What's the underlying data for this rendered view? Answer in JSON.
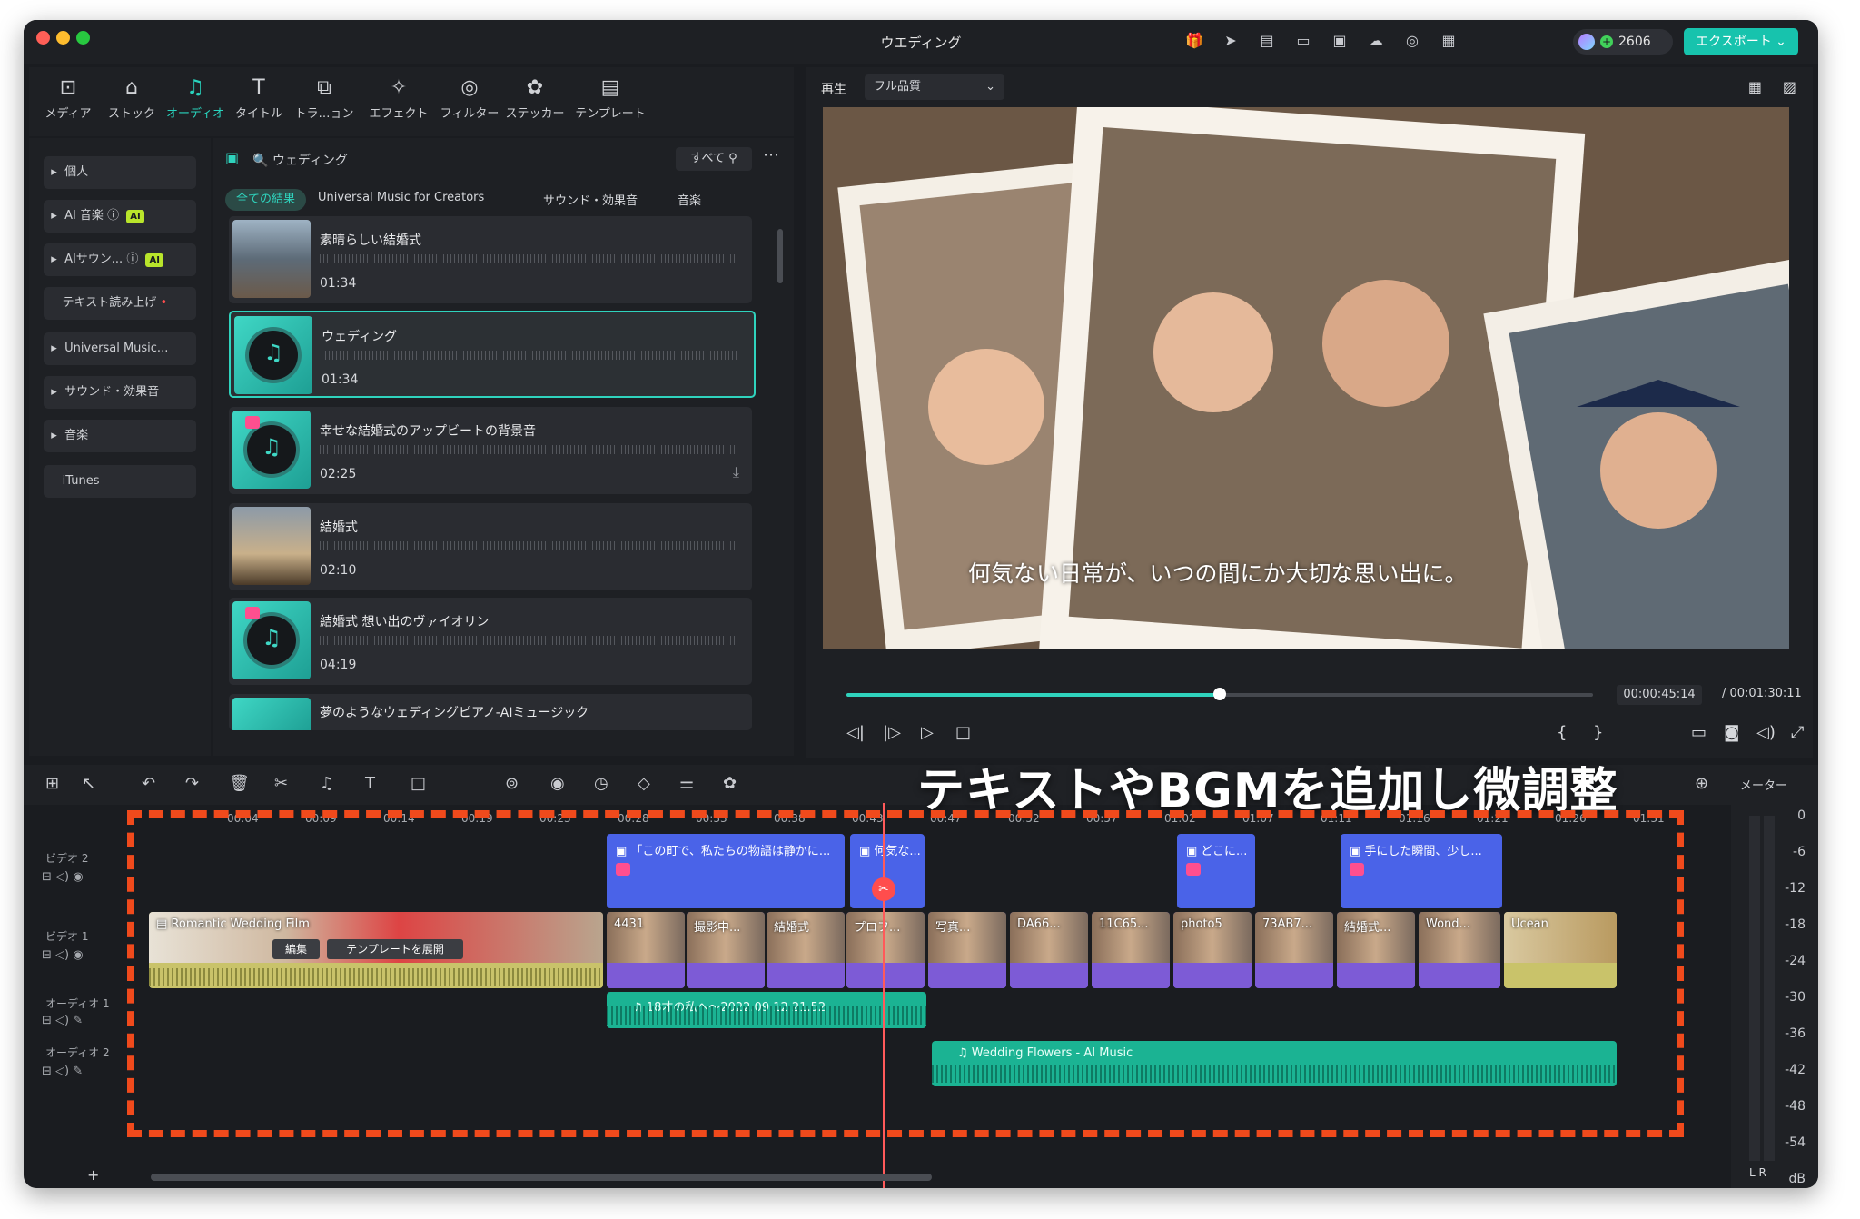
{
  "window": {
    "title": "ウエディング"
  },
  "header": {
    "credits": "2606",
    "export_label": "エクスポート"
  },
  "toolbar": {
    "tools": [
      {
        "label": "メディア"
      },
      {
        "label": "ストック"
      },
      {
        "label": "オーディオ"
      },
      {
        "label": "タイトル"
      },
      {
        "label": "トラ…ョン"
      },
      {
        "label": "エフェクト"
      },
      {
        "label": "フィルター"
      },
      {
        "label": "ステッカー"
      },
      {
        "label": "テンプレート"
      }
    ]
  },
  "sidebar": {
    "items": [
      {
        "label": "個人"
      },
      {
        "label": "AI 音楽"
      },
      {
        "label": "AIサウン..."
      },
      {
        "label": "テキスト読み上げ"
      },
      {
        "label": "Universal Music..."
      },
      {
        "label": "サウンド・効果音"
      },
      {
        "label": "音楽"
      },
      {
        "label": "iTunes"
      }
    ],
    "ai_badge": "AI"
  },
  "library": {
    "search_value": "ウェディング",
    "filter_label": "すべて",
    "tabs": [
      {
        "label": "全ての結果"
      },
      {
        "label": "Universal Music for Creators"
      },
      {
        "label": "サウンド・効果音"
      },
      {
        "label": "音楽"
      }
    ],
    "items": [
      {
        "title": "素晴らしい結婚式",
        "duration": "01:34"
      },
      {
        "title": "ウェディング",
        "duration": "01:34"
      },
      {
        "title": "幸せな結婚式のアップビートの背景音",
        "duration": "02:25"
      },
      {
        "title": "結婚式",
        "duration": "02:10"
      },
      {
        "title": "結婚式 想い出のヴァイオリン",
        "duration": "04:19"
      },
      {
        "title": "夢のようなウェディングピアノ-AIミュージック",
        "duration": ""
      }
    ]
  },
  "preview": {
    "play_label": "再生",
    "quality": "フル品質",
    "subtitle": "何気ない日常が、いつの間にか大切な思い出に。",
    "current_time": "00:00:45:14",
    "total_time": "/ 00:01:30:11",
    "progress": 0.5
  },
  "timeline": {
    "ruler": [
      "00:04",
      "00:09",
      "00:14",
      "00:19",
      "00:23",
      "00:28",
      "00:33",
      "00:38",
      "00:43",
      "00:47",
      "00:52",
      "00:57",
      "01:02",
      "01:07",
      "01:11",
      "01:16",
      "01:21",
      "01:26",
      "01:31"
    ],
    "tracks": [
      {
        "label": "ビデオ 2"
      },
      {
        "label": "ビデオ 1"
      },
      {
        "label": "オーディオ 1"
      },
      {
        "label": "オーディオ 2"
      }
    ],
    "title_clips": [
      {
        "text": "「この町で、私たちの物語は静かに..."
      },
      {
        "text": "何気な..."
      },
      {
        "text": "どこに..."
      },
      {
        "text": "手にした瞬間、少し..."
      }
    ],
    "video_clips": [
      {
        "text": "Romantic Wedding Film"
      },
      {
        "text": "4431"
      },
      {
        "text": "撮影中..."
      },
      {
        "text": "結婚式"
      },
      {
        "text": "プロフ..."
      },
      {
        "text": "写真..."
      },
      {
        "text": "DA66..."
      },
      {
        "text": "11C65..."
      },
      {
        "text": "photo5"
      },
      {
        "text": "73AB7..."
      },
      {
        "text": "結婚式..."
      },
      {
        "text": "Wond..."
      },
      {
        "text": "Ucean"
      }
    ],
    "edit_label": "編集",
    "expand_label": "テンプレートを展開",
    "audio_clips": [
      {
        "text": "18才の私へ～2022.09.12 21.52"
      },
      {
        "text": "Wedding Flowers - AI Music"
      }
    ]
  },
  "overlay": {
    "caption": "テキストやBGMを追加し微調整"
  },
  "meter": {
    "label": "メーター",
    "scale": [
      "0",
      "-6",
      "-12",
      "-18",
      "-24",
      "-30",
      "-36",
      "-42",
      "-48",
      "-54",
      "dB"
    ],
    "lr": "L  R"
  }
}
